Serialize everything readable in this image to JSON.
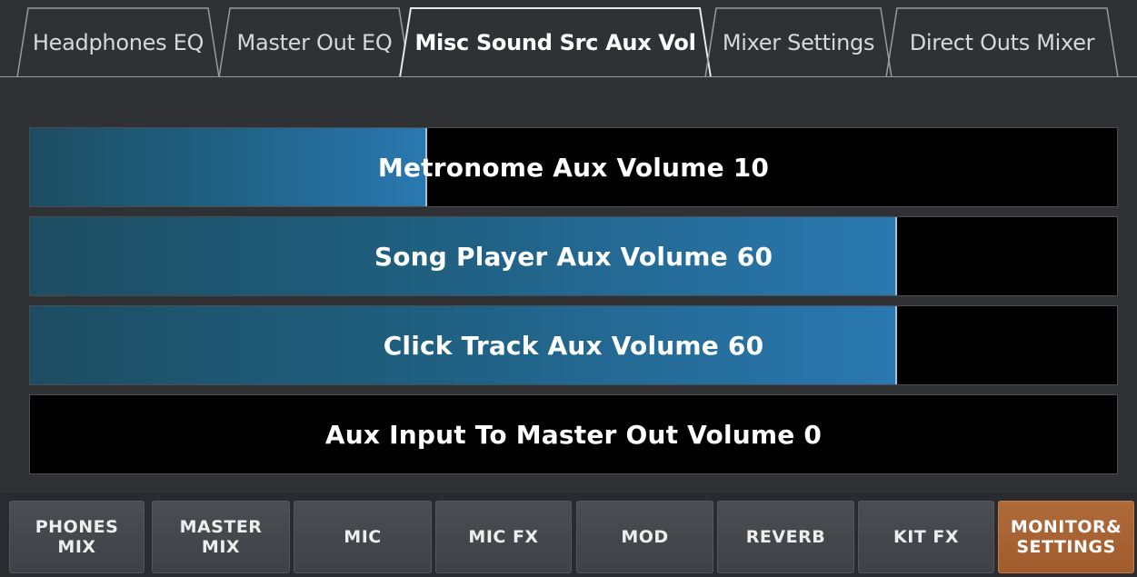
{
  "tabs": [
    {
      "label": "Headphones EQ",
      "active": false
    },
    {
      "label": "Master Out EQ",
      "active": false
    },
    {
      "label": "Misc Sound Src Aux Vol",
      "active": true
    },
    {
      "label": "Mixer Settings",
      "active": false
    },
    {
      "label": "Direct Outs Mixer",
      "active": false
    }
  ],
  "sliders": [
    {
      "label": "Metronome Aux Volume 10",
      "level_fraction": 0.365
    },
    {
      "label": "Song Player Aux Volume 60",
      "level_fraction": 0.798
    },
    {
      "label": "Click Track Aux Volume 60",
      "level_fraction": 0.798
    },
    {
      "label": "Aux Input To Master Out Volume 0",
      "level_fraction": 0.0
    }
  ],
  "bottom_buttons": [
    {
      "label": "PHONES\nMIX",
      "active": false
    },
    {
      "label": "MASTER\nMIX",
      "active": false
    },
    {
      "label": "MIC",
      "active": false
    },
    {
      "label": "MIC FX",
      "active": false
    },
    {
      "label": "MOD",
      "active": false
    },
    {
      "label": "REVERB",
      "active": false
    },
    {
      "label": "KIT FX",
      "active": false
    },
    {
      "label": "MONITOR&\nSETTINGS",
      "active": true
    }
  ],
  "colors": {
    "background": "#2f3134",
    "slider_fill": "#2a78b0",
    "active_button": "#b06a3a"
  }
}
